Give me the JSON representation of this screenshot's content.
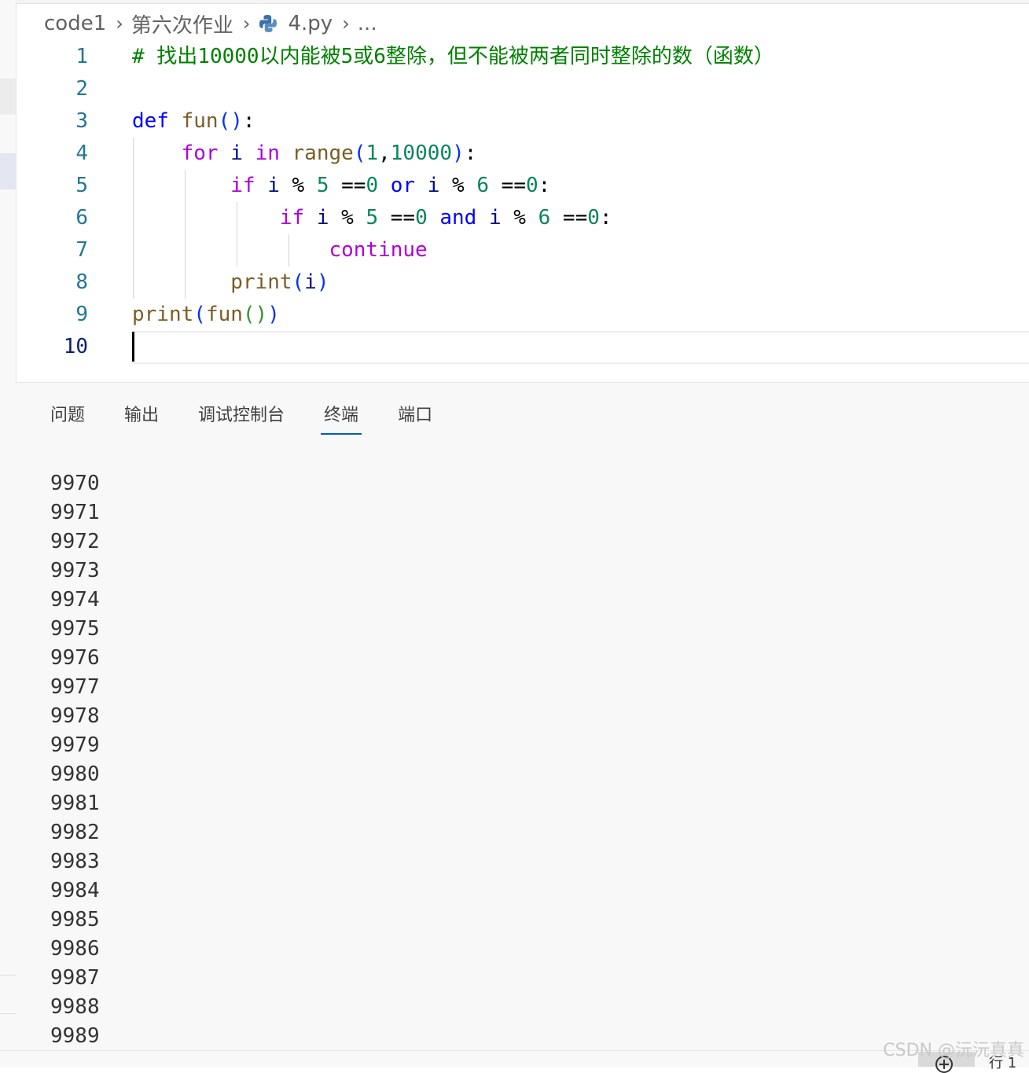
{
  "breadcrumb": {
    "folder": "code1",
    "subfolder": "第六次作业",
    "file": "4.py",
    "more": "..."
  },
  "editor": {
    "active_line": "10",
    "lines": [
      {
        "n": "1",
        "tokens": [
          {
            "t": "# 找出10000以内能被5或6整除，但不能被两者同时整除的数（函数）",
            "c": "cmt"
          }
        ]
      },
      {
        "n": "2",
        "tokens": []
      },
      {
        "n": "3",
        "tokens": [
          {
            "t": "def",
            "c": "kw"
          },
          {
            "t": " "
          },
          {
            "t": "fun",
            "c": "fn"
          },
          {
            "t": "()",
            "c": "br1"
          },
          {
            "t": ":"
          }
        ]
      },
      {
        "n": "4",
        "tokens": [
          {
            "t": "    "
          },
          {
            "t": "for",
            "c": "ctl"
          },
          {
            "t": " "
          },
          {
            "t": "i",
            "c": "var"
          },
          {
            "t": " "
          },
          {
            "t": "in",
            "c": "ctl"
          },
          {
            "t": " "
          },
          {
            "t": "range",
            "c": "fn"
          },
          {
            "t": "(",
            "c": "br1"
          },
          {
            "t": "1",
            "c": "num"
          },
          {
            "t": ","
          },
          {
            "t": "10000",
            "c": "num"
          },
          {
            "t": ")",
            "c": "br1"
          },
          {
            "t": ":"
          }
        ]
      },
      {
        "n": "5",
        "tokens": [
          {
            "t": "        "
          },
          {
            "t": "if",
            "c": "ctl"
          },
          {
            "t": " "
          },
          {
            "t": "i",
            "c": "var"
          },
          {
            "t": " % "
          },
          {
            "t": "5",
            "c": "num"
          },
          {
            "t": " =="
          },
          {
            "t": "0",
            "c": "num"
          },
          {
            "t": " "
          },
          {
            "t": "or",
            "c": "opk"
          },
          {
            "t": " "
          },
          {
            "t": "i",
            "c": "var"
          },
          {
            "t": " % "
          },
          {
            "t": "6",
            "c": "num"
          },
          {
            "t": " =="
          },
          {
            "t": "0",
            "c": "num"
          },
          {
            "t": ":"
          }
        ]
      },
      {
        "n": "6",
        "tokens": [
          {
            "t": "            "
          },
          {
            "t": "if",
            "c": "ctl"
          },
          {
            "t": " "
          },
          {
            "t": "i",
            "c": "var"
          },
          {
            "t": " % "
          },
          {
            "t": "5",
            "c": "num"
          },
          {
            "t": " =="
          },
          {
            "t": "0",
            "c": "num"
          },
          {
            "t": " "
          },
          {
            "t": "and",
            "c": "opk"
          },
          {
            "t": " "
          },
          {
            "t": "i",
            "c": "var"
          },
          {
            "t": " % "
          },
          {
            "t": "6",
            "c": "num"
          },
          {
            "t": " =="
          },
          {
            "t": "0",
            "c": "num"
          },
          {
            "t": ":"
          }
        ]
      },
      {
        "n": "7",
        "tokens": [
          {
            "t": "                "
          },
          {
            "t": "continue",
            "c": "ctl"
          }
        ]
      },
      {
        "n": "8",
        "tokens": [
          {
            "t": "        "
          },
          {
            "t": "print",
            "c": "fn"
          },
          {
            "t": "(",
            "c": "br1"
          },
          {
            "t": "i",
            "c": "var"
          },
          {
            "t": ")",
            "c": "br1"
          }
        ]
      },
      {
        "n": "9",
        "tokens": [
          {
            "t": "print",
            "c": "fn"
          },
          {
            "t": "(",
            "c": "br1"
          },
          {
            "t": "fun",
            "c": "fn"
          },
          {
            "t": "()",
            "c": "br2"
          },
          {
            "t": ")",
            "c": "br1"
          }
        ]
      },
      {
        "n": "10",
        "tokens": []
      }
    ]
  },
  "panel": {
    "tabs": [
      "问题",
      "输出",
      "调试控制台",
      "终端",
      "端口"
    ],
    "active_tab": "终端",
    "terminal_lines": [
      "9970",
      "9971",
      "9972",
      "9973",
      "9974",
      "9975",
      "9976",
      "9977",
      "9978",
      "9979",
      "9980",
      "9981",
      "9982",
      "9983",
      "9984",
      "9985",
      "9986",
      "9987",
      "9988",
      "9989"
    ]
  },
  "status": {
    "position": "行 1"
  },
  "watermark": "CSDN @沅沅真真",
  "icons": {
    "file_icon": "python-icon",
    "separator": "chevron-right-icon"
  },
  "colors": {
    "active_tab_underline": "#005fb8",
    "comment": "#008000",
    "keyword": "#0000ff",
    "control": "#af00db"
  }
}
